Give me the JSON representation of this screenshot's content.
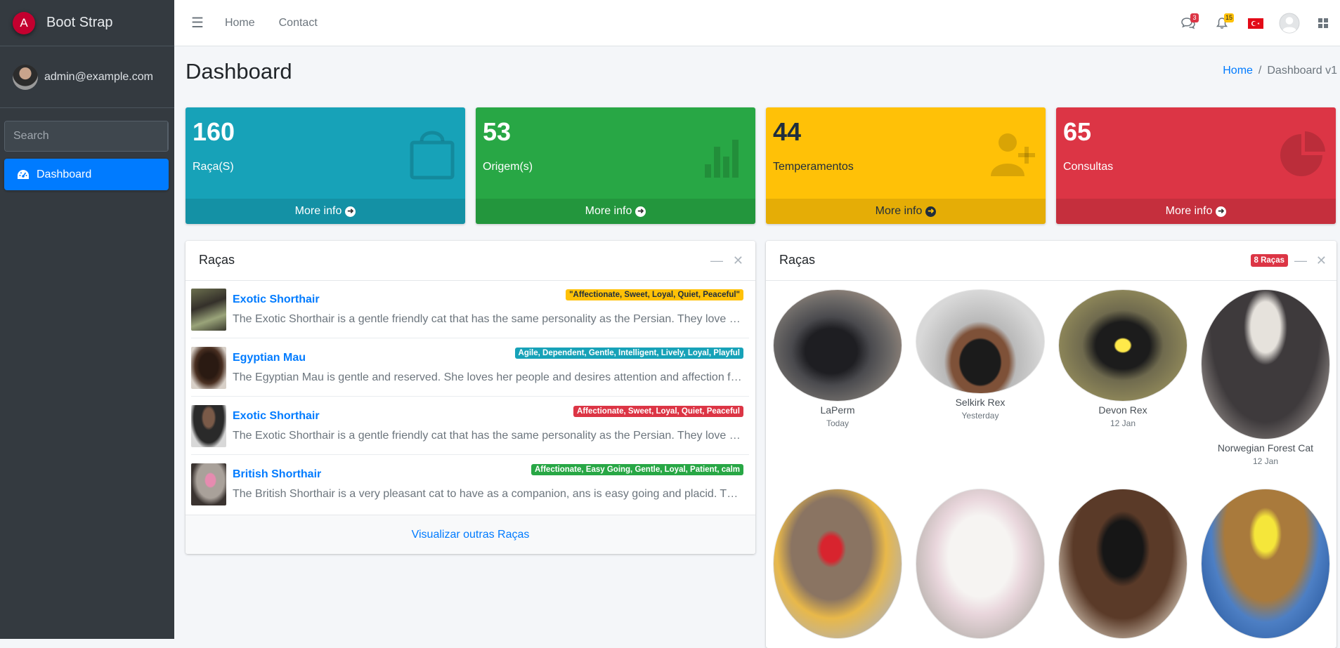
{
  "brand": {
    "name": "Boot Strap",
    "logo_letter": "A"
  },
  "user": {
    "email": "admin@example.com"
  },
  "sidebar": {
    "search_placeholder": "Search",
    "nav": [
      {
        "label": "Dashboard",
        "icon": "tachometer-icon",
        "active": true
      }
    ]
  },
  "topnav": {
    "links": [
      "Home",
      "Contact"
    ],
    "messages_count": "3",
    "notifications_count": "15"
  },
  "page": {
    "title": "Dashboard",
    "breadcrumb": [
      "Home",
      "Dashboard v1"
    ]
  },
  "stats": [
    {
      "value": "160",
      "label": "Raça(S)",
      "footer": "More info",
      "color": "#17a2b8",
      "icon": "shopping-bag-icon"
    },
    {
      "value": "53",
      "label": "Origem(s)",
      "footer": "More info",
      "color": "#28a745",
      "icon": "bar-chart-icon"
    },
    {
      "value": "44",
      "label": "Temperamentos",
      "footer": "More info",
      "color": "#ffc107",
      "icon": "user-plus-icon"
    },
    {
      "value": "65",
      "label": "Consultas",
      "footer": "More info",
      "color": "#dc3545",
      "icon": "pie-chart-icon"
    }
  ],
  "breeds_card": {
    "title": "Raças",
    "items": [
      {
        "name": "Exotic Shorthair",
        "tags": "\"Affectionate, Sweet, Loyal, Quiet, Peaceful\"",
        "tag_color": "#ffc107",
        "description": "The Exotic Shorthair is a gentle friendly cat that has the same personality as the Persian. They love having fun, playing and being in the company of people."
      },
      {
        "name": "Egyptian Mau",
        "tags": "Agile, Dependent, Gentle, Intelligent, Lively, Loyal, Playful",
        "tag_color": "#17a2b8",
        "description": "The Egyptian Mau is gentle and reserved. She loves her people and desires attention and affection from them but is wary of others."
      },
      {
        "name": "Exotic Shorthair",
        "tags": "Affectionate, Sweet, Loyal, Quiet, Peaceful",
        "tag_color": "#dc3545",
        "description": "The Exotic Shorthair is a gentle friendly cat that has the same personality as the Persian. They love having fun, playing and being in the company of people."
      },
      {
        "name": "British Shorthair",
        "tags": "Affectionate, Easy Going, Gentle, Loyal, Patient, calm",
        "tag_color": "#28a745",
        "description": "The British Shorthair is a very pleasant cat to have as a companion, ans is easy going and placid. The British is a fiercely loyal, loving cat."
      }
    ],
    "footer_link": "Visualizar outras Raças"
  },
  "members_card": {
    "title": "Raças",
    "badge": "8 Raças",
    "members": [
      {
        "name": "LaPerm",
        "date": "Today"
      },
      {
        "name": "Selkirk Rex",
        "date": "Yesterday"
      },
      {
        "name": "Devon Rex",
        "date": "12 Jan"
      },
      {
        "name": "Norwegian Forest Cat",
        "date": "12 Jan"
      },
      {
        "name": "",
        "date": ""
      },
      {
        "name": "",
        "date": ""
      },
      {
        "name": "",
        "date": ""
      },
      {
        "name": "",
        "date": ""
      }
    ]
  }
}
